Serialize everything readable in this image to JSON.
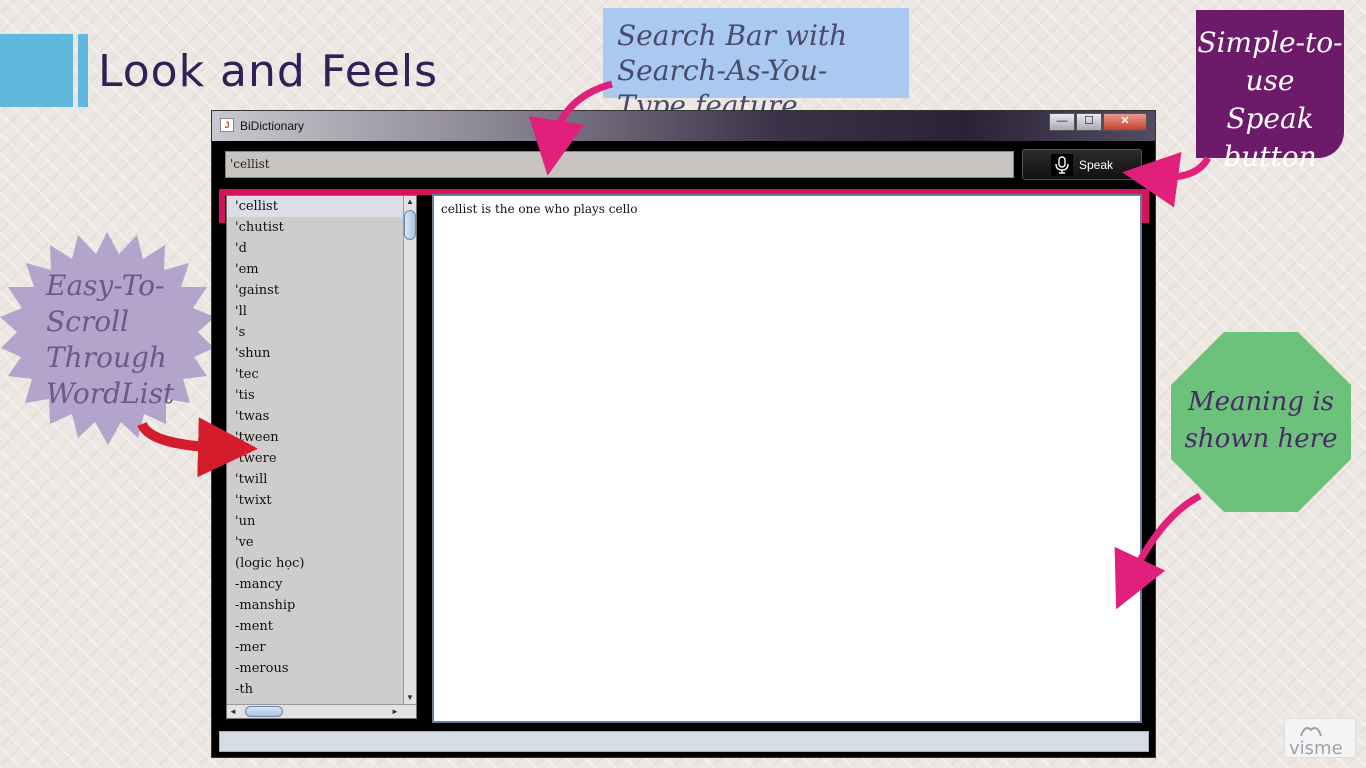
{
  "slide": {
    "title": "Look and Feels"
  },
  "callouts": {
    "search": "Search Bar with Search-As-You-Type feature",
    "speak": [
      "Simple-to-",
      "use",
      "Speak button"
    ],
    "scroll": [
      "Easy-To-",
      "Scroll",
      "Through",
      "WordList"
    ],
    "meaning": [
      "Meaning is",
      "shown here"
    ]
  },
  "window": {
    "title": "BiDictionary",
    "controls": {
      "minimize": "—",
      "maximize": "☐",
      "close": "✕"
    }
  },
  "search": {
    "value": "'cellist"
  },
  "speak_button": {
    "label": "Speak",
    "icon": "microphone-icon"
  },
  "word_list": {
    "selected_index": 0,
    "items": [
      "'cellist",
      "'chutist",
      "'d",
      "'em",
      "'gainst",
      "'ll",
      "'s",
      "'shun",
      "'tec",
      "'tis",
      "'twas",
      "'tween",
      "'twere",
      "'twill",
      "'twixt",
      "'un",
      "'ve",
      "(logic học)",
      "-mancy",
      "-manship",
      "-ment",
      "-mer",
      "-merous",
      "-th"
    ],
    "scrollbar": {
      "up": "▲",
      "down": "▼",
      "left": "◄",
      "right": "►"
    }
  },
  "meaning": {
    "text": "cellist is the one who plays cello"
  },
  "colors": {
    "accent_pink": "#d4145a",
    "callout_search_bg": "#a9c9f1",
    "callout_speak_bg": "#6d1a6b",
    "callout_scroll_bg": "#b3a4cc",
    "callout_meaning_bg": "#6cc27a",
    "arrow_pink": "#e0207a",
    "arrow_red": "#d41c2c",
    "title_color": "#2b2356"
  },
  "watermark": {
    "brand": "visme"
  }
}
